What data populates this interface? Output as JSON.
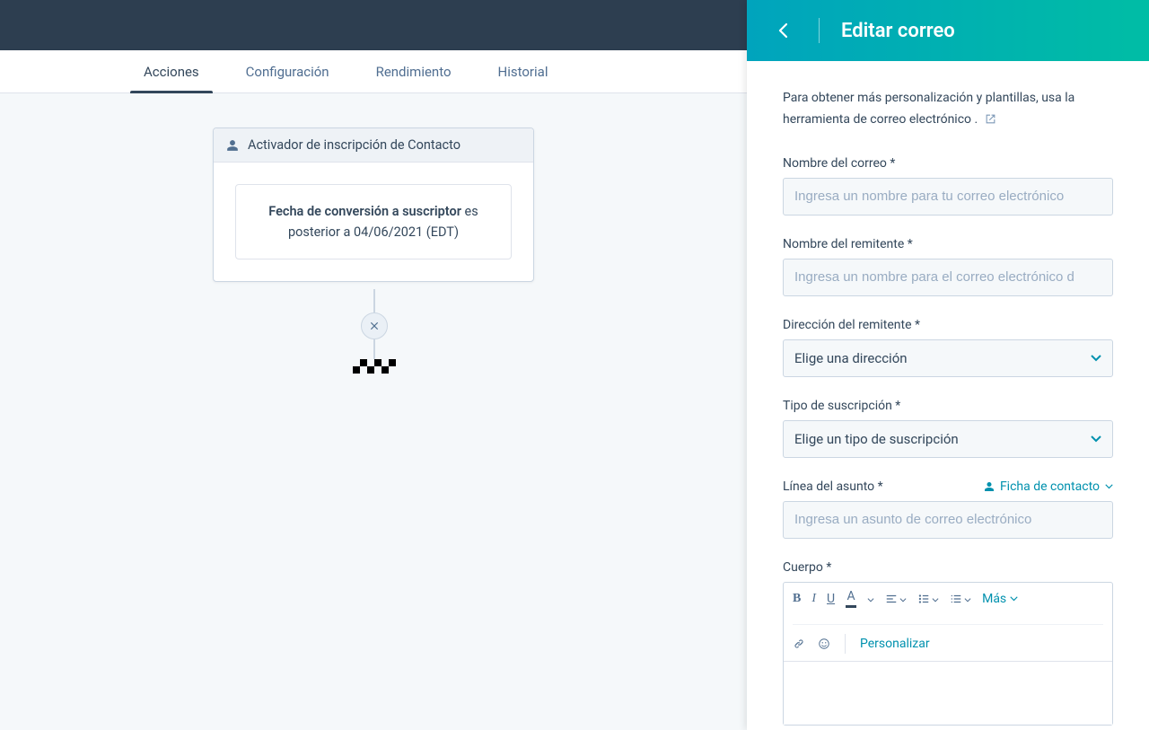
{
  "tabs": {
    "actions": "Acciones",
    "config": "Configuración",
    "performance": "Rendimiento",
    "history": "Historial"
  },
  "trigger": {
    "header": "Activador de inscripción de Contacto",
    "line_bold": "Fecha de conversión a suscriptor",
    "line_mid": " es posterior a ",
    "line_date": "04/06/2021 (EDT)"
  },
  "panel": {
    "title": "Editar correo",
    "help": "Para obtener más personalización y plantillas, usa la herramienta de correo electrónico .",
    "fields": {
      "email_name": {
        "label": "Nombre del correo *",
        "placeholder": "Ingresa un nombre para tu correo electrónico"
      },
      "sender_name": {
        "label": "Nombre del remitente *",
        "placeholder": "Ingresa un nombre para el correo electrónico d"
      },
      "sender_address": {
        "label": "Dirección del remitente *",
        "placeholder": "Elige una dirección"
      },
      "subscription_type": {
        "label": "Tipo de suscripción *",
        "placeholder": "Elige un tipo de suscripción"
      },
      "subject": {
        "label": "Línea del asunto *",
        "placeholder": "Ingresa un asunto de correo electrónico",
        "token": "Ficha de contacto"
      },
      "body": {
        "label": "Cuerpo *"
      }
    },
    "editor": {
      "more": "Más",
      "personalize": "Personalizar"
    }
  }
}
